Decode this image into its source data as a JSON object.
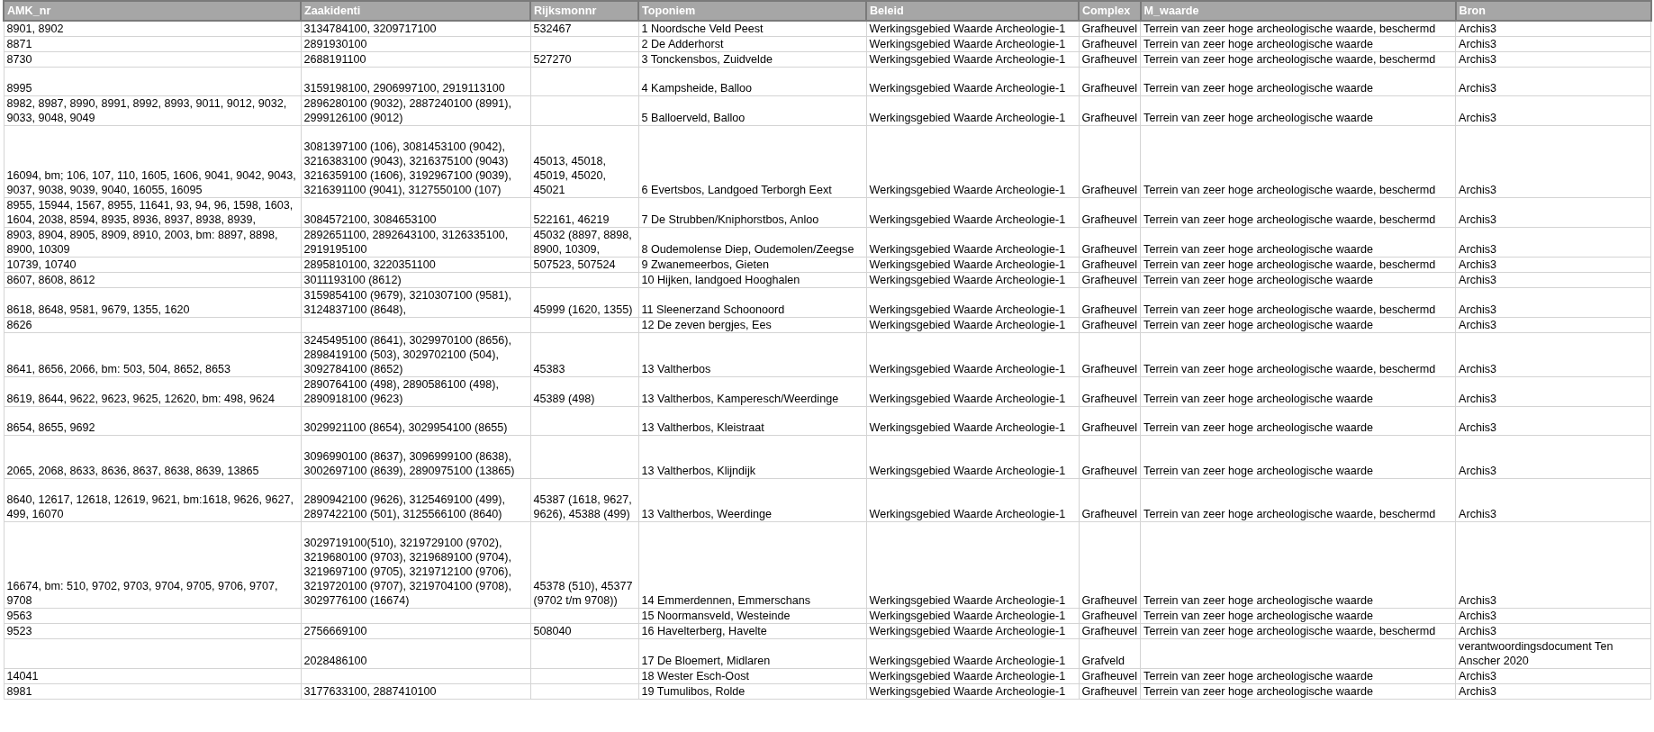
{
  "columns": [
    {
      "label": "AMK_nr"
    },
    {
      "label": "Zaakidenti"
    },
    {
      "label": "Rijksmonnr"
    },
    {
      "label": "Toponiem"
    },
    {
      "label": "Beleid"
    },
    {
      "label": "Complex"
    },
    {
      "label": "M_waarde"
    },
    {
      "label": "Bron"
    }
  ],
  "rows": [
    {
      "cells": [
        "8901, 8902",
        "3134784100, 3209717100",
        "532467",
        "1 Noordsche Veld Peest",
        "Werkingsgebied Waarde Archeologie-1",
        "Grafheuvel",
        "Terrein van zeer hoge archeologische waarde, beschermd",
        "Archis3"
      ]
    },
    {
      "cells": [
        "8871",
        "2891930100",
        null,
        "2 De Adderhorst",
        "Werkingsgebied Waarde Archeologie-1",
        "Grafheuvel",
        "Terrein van zeer hoge archeologische waarde",
        "Archis3"
      ]
    },
    {
      "cells": [
        "8730",
        "2688191100",
        "527270",
        "3 Tonckensbos, Zuidvelde",
        "Werkingsgebied Waarde Archeologie-1",
        "Grafheuvel",
        "Terrein van zeer hoge archeologische waarde, beschermd",
        "Archis3"
      ]
    },
    {
      "cells": [
        "8995",
        "3159198100, 2906997100, 2919113100",
        null,
        "4 Kampsheide, Balloo",
        "Werkingsgebied Waarde Archeologie-1",
        "Grafheuvel",
        "Terrein van zeer hoge archeologische waarde",
        "Archis3"
      ]
    },
    {
      "cells": [
        "8982, 8987, 8990, 8991, 8992, 8993, 9011, 9012, 9032, 9033, 9048, 9049",
        "2896280100 (9032), 2887240100 (8991), 2999126100 (9012)",
        null,
        "5 Balloerveld, Balloo",
        "Werkingsgebied Waarde Archeologie-1",
        "Grafheuvel",
        "Terrein van zeer hoge archeologische waarde",
        "Archis3"
      ]
    },
    {
      "cells": [
        "16094, bm; 106, 107, 110, 1605, 1606, 9041, 9042, 9043, 9037, 9038, 9039, 9040, 16055, 16095",
        "3081397100 (106), 3081453100 (9042), 3216383100 (9043), 3216375100 (9043) 3216359100 (1606), 3192967100 (9039), 3216391100 (9041), 3127550100 (107)",
        "45013, 45018, 45019, 45020, 45021",
        "6 Evertsbos, Landgoed Terborgh Eext",
        "Werkingsgebied Waarde Archeologie-1",
        "Grafheuvel",
        "Terrein van zeer hoge archeologische waarde, beschermd",
        "Archis3"
      ]
    },
    {
      "cells": [
        "8955, 15944, 1567, 8955, 11641, 93, 94, 96, 1598, 1603, 1604, 2038, 8594, 8935, 8936, 8937, 8938, 8939,",
        "3084572100, 3084653100",
        "522161, 46219",
        "7 De Strubben/Kniphorstbos, Anloo",
        "Werkingsgebied Waarde Archeologie-1",
        "Grafheuvel",
        "Terrein van zeer hoge archeologische waarde, beschermd",
        "Archis3"
      ]
    },
    {
      "cells": [
        "8903, 8904, 8905, 8909, 8910, 2003, bm: 8897, 8898, 8900, 10309",
        "2892651100, 2892643100, 3126335100, 2919195100",
        "45032 (8897, 8898, 8900, 10309,",
        "8 Oudemolense Diep, Oudemolen/Zeegse",
        "Werkingsgebied Waarde Archeologie-1",
        "Grafheuvel",
        "Terrein van zeer hoge archeologische waarde",
        "Archis3"
      ]
    },
    {
      "cells": [
        "10739, 10740",
        "2895810100, 3220351100",
        "507523, 507524",
        "9 Zwanemeerbos, Gieten",
        "Werkingsgebied Waarde Archeologie-1",
        "Grafheuvel",
        "Terrein van zeer hoge archeologische waarde, beschermd",
        "Archis3"
      ]
    },
    {
      "cells": [
        "8607, 8608, 8612",
        "3011193100 (8612)",
        null,
        "10 Hijken, landgoed Hooghalen",
        "Werkingsgebied Waarde Archeologie-1",
        "Grafheuvel",
        "Terrein van zeer hoge archeologische waarde",
        "Archis3"
      ]
    },
    {
      "cells": [
        "8618, 8648, 9581, 9679, 1355, 1620",
        "3159854100 (9679), 3210307100 (9581), 3124837100 (8648),",
        "45999 (1620, 1355)",
        "11 Sleenerzand Schoonoord",
        "Werkingsgebied Waarde Archeologie-1",
        "Grafheuvel",
        "Terrein van zeer hoge archeologische waarde, beschermd",
        "Archis3"
      ]
    },
    {
      "cells": [
        "8626",
        null,
        null,
        "12 De zeven bergjes, Ees",
        "Werkingsgebied Waarde Archeologie-1",
        "Grafheuvel",
        "Terrein van zeer hoge archeologische waarde",
        "Archis3"
      ]
    },
    {
      "cells": [
        "8641, 8656, 2066, bm: 503, 504, 8652, 8653",
        "3245495100 (8641), 3029970100 (8656), 2898419100 (503), 3029702100 (504), 3092784100 (8652)",
        "45383",
        "13 Valtherbos",
        "Werkingsgebied Waarde Archeologie-1",
        "Grafheuvel",
        "Terrein van zeer hoge archeologische waarde, beschermd",
        "Archis3"
      ]
    },
    {
      "cells": [
        "8619, 8644, 9622, 9623,  9625, 12620, bm: 498, 9624",
        "2890764100 (498), 2890586100 (498), 2890918100 (9623)",
        "45389 (498)",
        "13 Valtherbos, Kamperesch/Weerdinge",
        "Werkingsgebied Waarde Archeologie-1",
        "Grafheuvel",
        "Terrein van zeer hoge archeologische waarde",
        "Archis3"
      ]
    },
    {
      "cells": [
        "8654, 8655, 9692",
        "3029921100 (8654), 3029954100 (8655)",
        null,
        "13 Valtherbos, Kleistraat",
        "Werkingsgebied Waarde Archeologie-1",
        "Grafheuvel",
        "Terrein van zeer hoge archeologische waarde",
        "Archis3"
      ]
    },
    {
      "cells": [
        "2065, 2068, 8633, 8636, 8637, 8638, 8639, 13865",
        "3096990100 (8637), 3096999100 (8638), 3002697100 (8639), 2890975100 (13865)",
        null,
        "13 Valtherbos, Klijndijk",
        "Werkingsgebied Waarde Archeologie-1",
        "Grafheuvel",
        "Terrein van zeer hoge archeologische waarde",
        "Archis3"
      ]
    },
    {
      "cells": [
        "8640, 12617, 12618, 12619, 9621, bm:1618, 9626, 9627, 499, 16070",
        "2890942100 (9626), 3125469100 (499), 2897422100 (501), 3125566100 (8640)",
        "45387 (1618, 9627, 9626), 45388 (499)",
        "13 Valtherbos, Weerdinge",
        "Werkingsgebied Waarde Archeologie-1",
        "Grafheuvel",
        "Terrein van zeer hoge archeologische waarde, beschermd",
        "Archis3"
      ]
    },
    {
      "cells": [
        "16674, bm: 510, 9702, 9703, 9704, 9705, 9706, 9707, 9708",
        "3029719100(510), 3219729100 (9702), 3219680100 (9703), 3219689100 (9704), 3219697100 (9705), 3219712100 (9706), 3219720100 (9707), 3219704100 (9708), 3029776100 (16674)",
        "45378 (510), 45377 (9702 t/m 9708))",
        "14 Emmerdennen, Emmerschans",
        "Werkingsgebied Waarde Archeologie-1",
        "Grafheuvel",
        "Terrein van zeer hoge archeologische waarde",
        "Archis3"
      ]
    },
    {
      "cells": [
        "9563",
        null,
        null,
        "15 Noormansveld, Westeinde",
        "Werkingsgebied Waarde Archeologie-1",
        "Grafheuvel",
        "Terrein van zeer hoge archeologische waarde",
        "Archis3"
      ]
    },
    {
      "cells": [
        "9523",
        "2756669100",
        "508040",
        "16 Havelterberg, Havelte",
        "Werkingsgebied Waarde Archeologie-1",
        "Grafheuvel",
        "Terrein van zeer hoge archeologische waarde, beschermd",
        "Archis3"
      ]
    },
    {
      "cells": [
        null,
        "2028486100",
        null,
        "17 De Bloemert, Midlaren",
        "Werkingsgebied Waarde Archeologie-1",
        "Grafveld",
        null,
        "verantwoordingsdocument Ten Anscher 2020"
      ]
    },
    {
      "cells": [
        "14041",
        null,
        null,
        "18 Wester Esch-Oost",
        "Werkingsgebied Waarde Archeologie-1",
        "Grafheuvel",
        "Terrein van zeer hoge archeologische waarde",
        "Archis3"
      ]
    },
    {
      "cells": [
        "8981",
        "3177633100, 2887410100",
        null,
        "19 Tumulibos, Rolde",
        "Werkingsgebied Waarde Archeologie-1",
        "Grafheuvel",
        "Terrein van zeer hoge archeologische waarde",
        "Archis3"
      ]
    }
  ]
}
